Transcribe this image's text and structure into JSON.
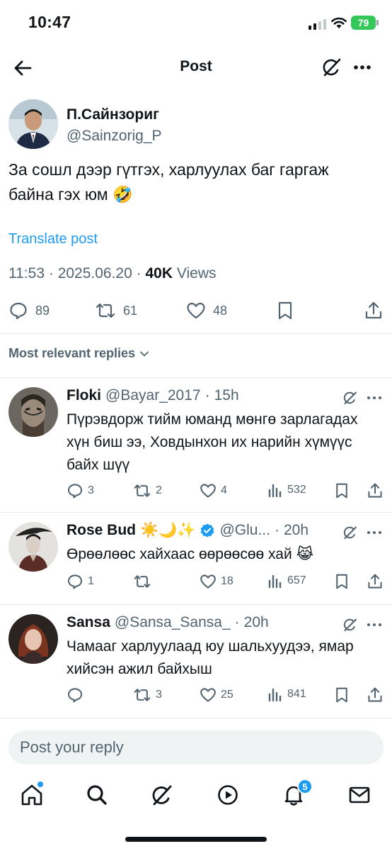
{
  "status_bar": {
    "time": "10:47",
    "battery": "79",
    "battery_color": "#34c759"
  },
  "header": {
    "title": "Post",
    "icons": [
      "back-arrow-icon",
      "grok-icon",
      "more-icon"
    ]
  },
  "post": {
    "author_name": "П.Сайнзориг",
    "author_handle": "@Sainzorig_P",
    "text": "За сошл дээр гүтгэх, харлуулах баг гаргаж байна гэх юм",
    "emoji": "🤣",
    "translate_label": "Translate post",
    "time": "11:53",
    "date": "2025.06.20",
    "views_count": "40K",
    "views_label": "Views",
    "separator": "·",
    "replies": "89",
    "reposts": "61",
    "likes": "48"
  },
  "replies_filter": "Most relevant replies",
  "replies": [
    {
      "name": "Floki",
      "handle": "@Bayar_2017",
      "time": "15h",
      "text": "Пүрэвдорж тийм юманд мөнгө зарлагадах хүн биш ээ, Ховдынхон их нарийн хүмүүс байх шүү",
      "replies": "3",
      "reposts": "2",
      "likes": "4",
      "views": "532"
    },
    {
      "name": "Rose Bud",
      "name_emojis": "☀️🌙✨",
      "verified": true,
      "handle": "@Glu...",
      "time": "20h",
      "text": "Өрөөлөөс хайхаас өөрөөсөө хай",
      "emoji": "😹",
      "replies": "1",
      "reposts": "",
      "likes": "18",
      "views": "657"
    },
    {
      "name": "Sansa",
      "handle": "@Sansa_Sansa_",
      "time": "20h",
      "text": "Чамааг харлуулаад юу шальхуудээ, ямар хийсэн ажил байхыш",
      "replies": "",
      "reposts": "3",
      "likes": "25",
      "views": "841"
    }
  ],
  "composer": {
    "placeholder": "Post your reply"
  },
  "tabbar": {
    "notification_count": "5",
    "accent": "#1d9bf0"
  }
}
